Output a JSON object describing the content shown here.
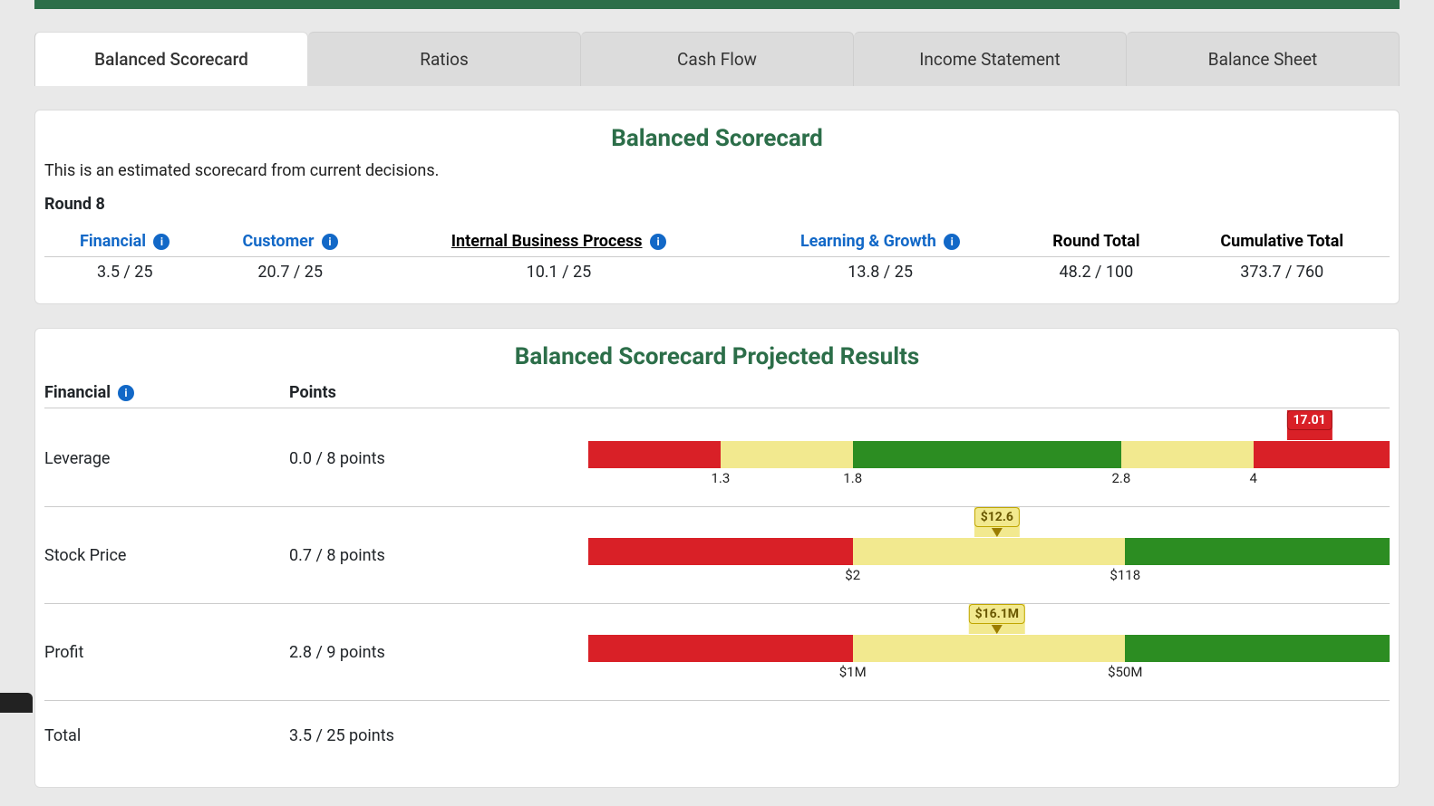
{
  "tabs": {
    "balanced_scorecard": "Balanced Scorecard",
    "ratios": "Ratios",
    "cash_flow": "Cash Flow",
    "income_statement": "Income Statement",
    "balance_sheet": "Balance Sheet"
  },
  "scorecard_panel": {
    "title": "Balanced Scorecard",
    "subtext": "This is an estimated scorecard from current decisions.",
    "round_label": "Round 8",
    "headers": {
      "financial": "Financial",
      "customer": "Customer",
      "internal": "Internal Business Process",
      "learning": "Learning & Growth",
      "round_total": "Round Total",
      "cumulative_total": "Cumulative Total"
    },
    "values": {
      "financial": "3.5 / 25",
      "customer": "20.7 / 25",
      "internal": "10.1 / 25",
      "learning": "13.8 / 25",
      "round_total": "48.2 / 100",
      "cumulative_total": "373.7 / 760"
    }
  },
  "projected_panel": {
    "title": "Balanced Scorecard Projected Results",
    "category_header": "Financial",
    "points_header": "Points",
    "rows": {
      "leverage": {
        "name": "Leverage",
        "points": "0.0 / 8 points",
        "segments": [
          {
            "color": "red",
            "pct": 16.5
          },
          {
            "color": "yellow",
            "pct": 16.5
          },
          {
            "color": "green",
            "pct": 33.5
          },
          {
            "color": "yellow",
            "pct": 16.5
          },
          {
            "color": "red",
            "pct": 17.0
          }
        ],
        "ticks": [
          {
            "label": "1.3",
            "pct": 16.5
          },
          {
            "label": "1.8",
            "pct": 33.0
          },
          {
            "label": "2.8",
            "pct": 66.5
          },
          {
            "label": "4",
            "pct": 83.0
          }
        ],
        "marker": {
          "label": "17.01",
          "pct": 90,
          "color": "red"
        }
      },
      "stock_price": {
        "name": "Stock Price",
        "points": "0.7 / 8 points",
        "segments": [
          {
            "color": "red",
            "pct": 33.0
          },
          {
            "color": "yellow",
            "pct": 34.0
          },
          {
            "color": "green",
            "pct": 33.0
          }
        ],
        "ticks": [
          {
            "label": "$2",
            "pct": 33.0
          },
          {
            "label": "$118",
            "pct": 67.0
          }
        ],
        "marker": {
          "label": "$12.6",
          "pct": 51,
          "color": "yellow"
        }
      },
      "profit": {
        "name": "Profit",
        "points": "2.8 / 9 points",
        "segments": [
          {
            "color": "red",
            "pct": 33.0
          },
          {
            "color": "yellow",
            "pct": 34.0
          },
          {
            "color": "green",
            "pct": 33.0
          }
        ],
        "ticks": [
          {
            "label": "$1M",
            "pct": 33.0
          },
          {
            "label": "$50M",
            "pct": 67.0
          }
        ],
        "marker": {
          "label": "$16.1M",
          "pct": 51,
          "color": "yellow"
        }
      },
      "total": {
        "name": "Total",
        "points": "3.5 / 25 points"
      }
    }
  },
  "info_glyph": "i",
  "chart_data": [
    {
      "type": "bar",
      "title": "Leverage range indicator",
      "metric": "Leverage",
      "points": "0.0 / 8",
      "thresholds": [
        1.3,
        1.8,
        2.8,
        4
      ],
      "zones": [
        "red",
        "yellow",
        "green",
        "yellow",
        "red"
      ],
      "current_value": 17.01,
      "current_zone": "red"
    },
    {
      "type": "bar",
      "title": "Stock Price range indicator",
      "metric": "Stock Price",
      "points": "0.7 / 8",
      "thresholds": [
        2,
        118
      ],
      "zones": [
        "red",
        "yellow",
        "green"
      ],
      "unit": "$",
      "current_value": 12.6,
      "current_zone": "yellow"
    },
    {
      "type": "bar",
      "title": "Profit range indicator",
      "metric": "Profit",
      "points": "2.8 / 9",
      "thresholds": [
        1,
        50
      ],
      "zones": [
        "red",
        "yellow",
        "green"
      ],
      "unit": "$M",
      "current_value": 16.1,
      "current_zone": "yellow"
    }
  ]
}
